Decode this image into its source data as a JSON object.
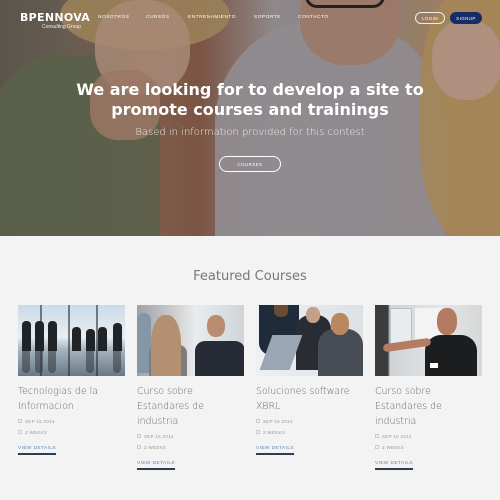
{
  "nav": {
    "logo": {
      "name": "BPENNOVA",
      "tagline": "Consulting Group"
    },
    "menu": [
      "NOSOTROS",
      "CURSOS",
      "ENTRENAMIENTO",
      "SOPORTE",
      "CONTACTO"
    ],
    "login_label": "LOGIN",
    "signup_label": "SIGNUP"
  },
  "hero": {
    "title_line1": "We are looking for to develop a site to",
    "title_line2": "promote courses and trainings",
    "subtitle": "Based in information provided for this contest",
    "cta_label": "COURSES"
  },
  "featured": {
    "title": "Featured Courses",
    "courses": [
      {
        "title": "Tecnologias de la Informacion",
        "date": "SEP 15 2014",
        "duration": "3 WEEKS",
        "link": "VIEW DETAILS",
        "image": "business-people-silhouettes-office-window"
      },
      {
        "title": "Curso sobre Estandares de industria",
        "date": "SEP 15 2014",
        "duration": "3 WEEKS",
        "link": "VIEW DETAILS",
        "image": "business-meeting-at-desk"
      },
      {
        "title": "Soluciones software XBRL",
        "date": "SEP 15 2014",
        "duration": "3 WEEKS",
        "link": "VIEW DETAILS",
        "image": "team-around-laptop"
      },
      {
        "title": "Curso sobre Estandares de industria",
        "date": "SEP 15 2014",
        "duration": "3 WEEKS",
        "link": "VIEW DETAILS",
        "image": "presenter-speaking"
      }
    ]
  },
  "colors": {
    "signup_bg": "#172c66",
    "link": "#5a86b7",
    "link_underline": "#2e3d52",
    "page_bg": "#f3f3f3"
  }
}
